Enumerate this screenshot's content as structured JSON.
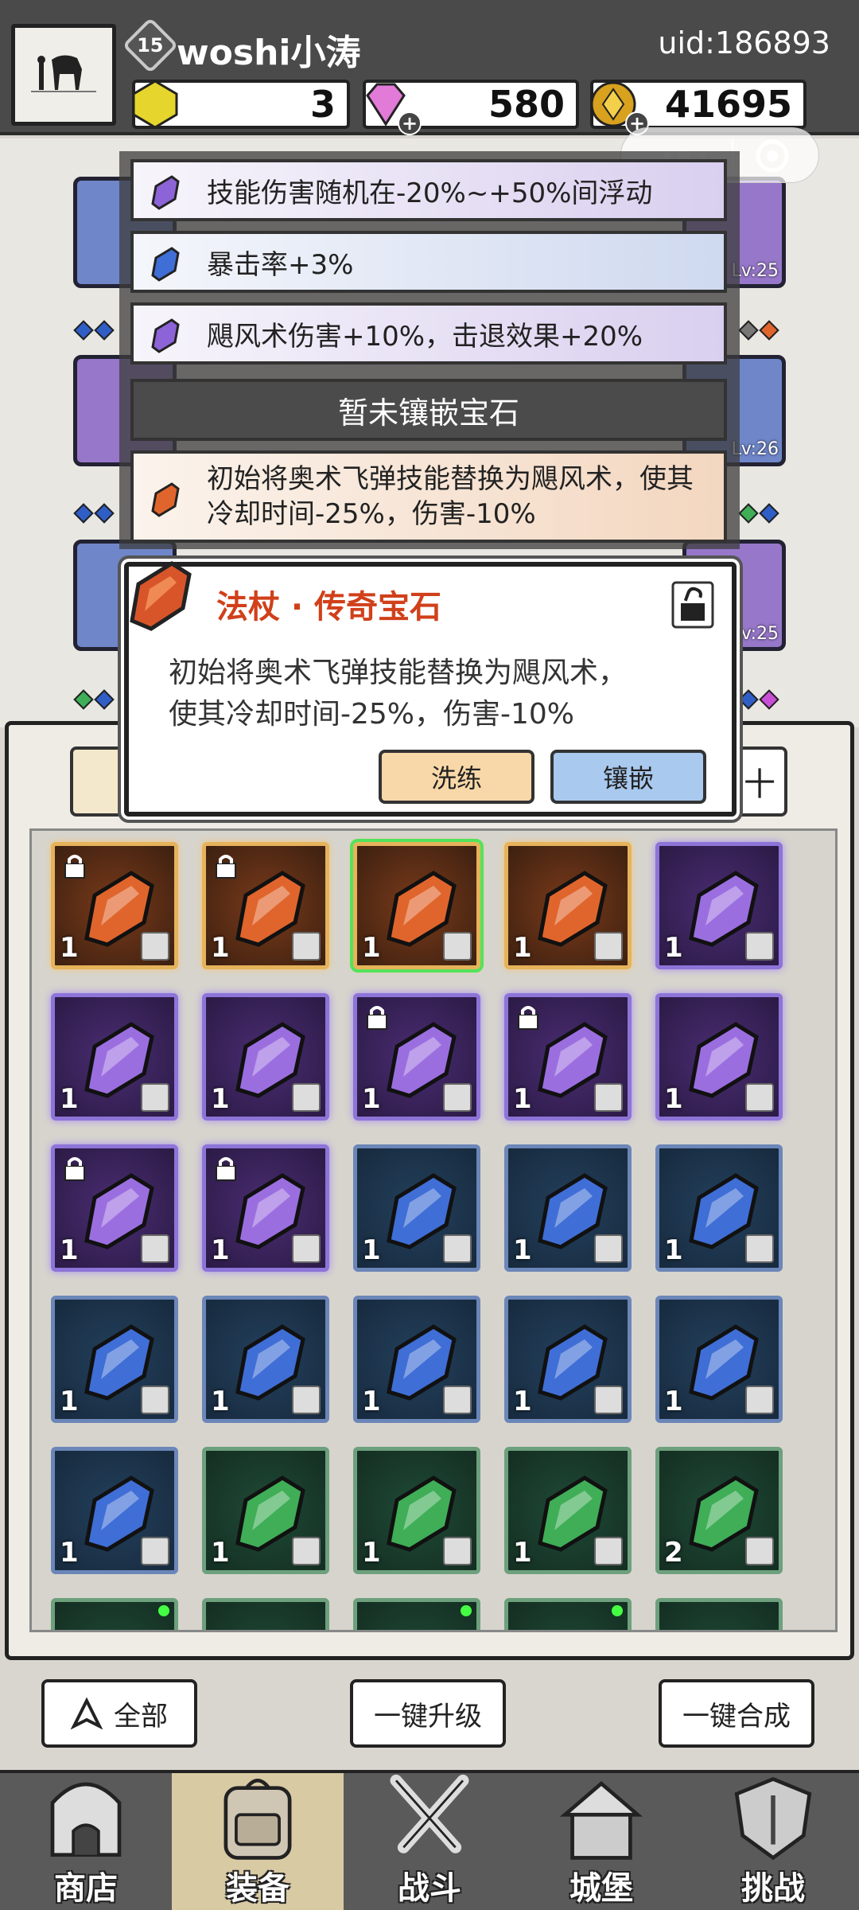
{
  "header": {
    "level": "15",
    "username": "woshi小涛",
    "uid": "uid:186893",
    "resources": {
      "gold_crystal": "3",
      "gems": "580",
      "coins": "41695"
    }
  },
  "affixes": [
    {
      "text": "技能伤害随机在-20%~+50%间浮动",
      "color": "purple"
    },
    {
      "text": "暴击率+3%",
      "color": "blue"
    },
    {
      "text": "飓风术伤害+10%，击退效果+20%",
      "color": "purple"
    },
    {
      "text": "暂未镶嵌宝石",
      "color": "empty"
    },
    {
      "text": "初始将奥术飞弹技能替换为飓风术，使其冷却时间-25%，伤害-10%",
      "color": "orange"
    }
  ],
  "equipment_levels": [
    "Lv:25",
    "Lv:26",
    "Lv:25"
  ],
  "popup": {
    "title": "法杖 · 传奇宝石",
    "desc_line1": "初始将奥术飞弹技能替换为飓风术，",
    "desc_line2": "使其冷却时间-25%，伤害-10%",
    "wash_label": "洗练",
    "inlay_label": "镶嵌"
  },
  "inventory": {
    "tab_right_label": "十",
    "rows": [
      [
        {
          "color": "orange",
          "qty": "1",
          "locked": true
        },
        {
          "color": "orange",
          "qty": "1",
          "locked": true
        },
        {
          "color": "orange",
          "qty": "1",
          "locked": false,
          "selected": true
        },
        {
          "color": "orange",
          "qty": "1",
          "locked": false
        },
        {
          "color": "purple",
          "qty": "1",
          "locked": false
        }
      ],
      [
        {
          "color": "purple",
          "qty": "1",
          "locked": false
        },
        {
          "color": "purple",
          "qty": "1",
          "locked": false
        },
        {
          "color": "purple",
          "qty": "1",
          "locked": true
        },
        {
          "color": "purple",
          "qty": "1",
          "locked": true
        },
        {
          "color": "purple",
          "qty": "1",
          "locked": false
        }
      ],
      [
        {
          "color": "purple",
          "qty": "1",
          "locked": true
        },
        {
          "color": "purple",
          "qty": "1",
          "locked": true
        },
        {
          "color": "blue",
          "qty": "1",
          "locked": false
        },
        {
          "color": "blue",
          "qty": "1",
          "locked": false
        },
        {
          "color": "blue",
          "qty": "1",
          "locked": false
        }
      ],
      [
        {
          "color": "blue",
          "qty": "1",
          "locked": false
        },
        {
          "color": "blue",
          "qty": "1",
          "locked": false
        },
        {
          "color": "blue",
          "qty": "1",
          "locked": false
        },
        {
          "color": "blue",
          "qty": "1",
          "locked": false
        },
        {
          "color": "blue",
          "qty": "1",
          "locked": false
        }
      ],
      [
        {
          "color": "blue",
          "qty": "1",
          "locked": false
        },
        {
          "color": "green",
          "qty": "1",
          "locked": false
        },
        {
          "color": "green",
          "qty": "1",
          "locked": false
        },
        {
          "color": "green",
          "qty": "1",
          "locked": false
        },
        {
          "color": "green",
          "qty": "2",
          "locked": false
        }
      ]
    ]
  },
  "actions": {
    "all_label": "全部",
    "upgrade_label": "一键升级",
    "merge_label": "一键合成"
  },
  "nav": [
    {
      "label": "商店",
      "icon": "shop-icon"
    },
    {
      "label": "装备",
      "icon": "backpack-icon",
      "active": true
    },
    {
      "label": "战斗",
      "icon": "crossed-swords-icon"
    },
    {
      "label": "城堡",
      "icon": "castle-icon"
    },
    {
      "label": "挑战",
      "icon": "shield-icon"
    }
  ],
  "colors": {
    "orange_gem": "#e0652c",
    "purple_gem": "#9b6ee0",
    "blue_gem": "#3f6ed6",
    "green_gem": "#3fae57",
    "popup_title": "#d0401a"
  }
}
